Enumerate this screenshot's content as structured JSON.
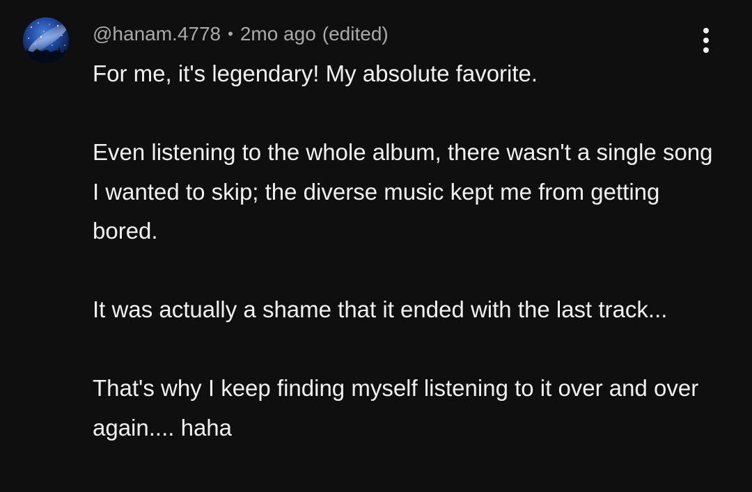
{
  "comment": {
    "author_handle": "@hanam.4778",
    "separator": "•",
    "timestamp": "2mo ago",
    "edited_label": "(edited)",
    "avatar_icon": "starry-night-avatar-icon",
    "menu_icon": "more-vertical-icon",
    "paragraphs": [
      "For me, it's legendary! My absolute favorite.",
      "Even listening to the whole album, there wasn't a single song I wanted to skip; the diverse music kept me from getting bored.",
      "It was actually a shame that it ended with the last track...",
      "That's why I keep finding myself listening to it over and over again.... haha"
    ]
  },
  "colors": {
    "background": "#0f0f0f",
    "text_primary": "#f1f1f1",
    "text_secondary": "#aaaaaa"
  }
}
